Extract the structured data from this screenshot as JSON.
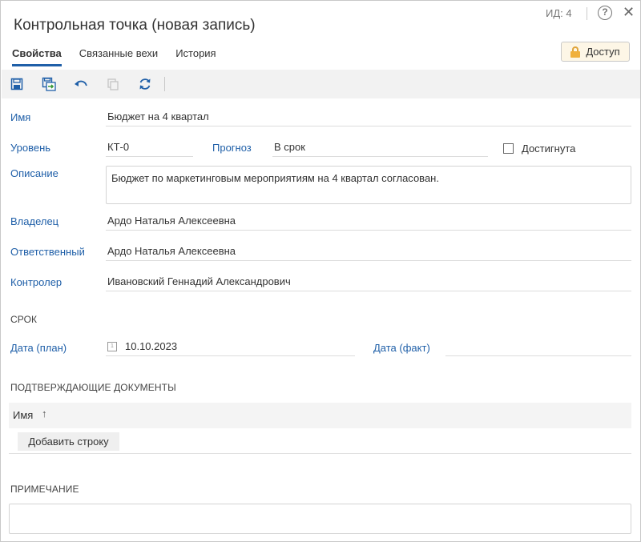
{
  "header": {
    "title": "Контрольная точка (новая запись)",
    "id_label": "ИД: 4",
    "help_symbol": "?",
    "close_symbol": "✕"
  },
  "tabs": [
    {
      "label": "Свойства",
      "active": true
    },
    {
      "label": "Связанные вехи",
      "active": false
    },
    {
      "label": "История",
      "active": false
    }
  ],
  "access_button": {
    "label": "Доступ",
    "icon": "lock-icon"
  },
  "toolbar": {
    "buttons": [
      "save-icon",
      "save-and-close-icon",
      "undo-icon",
      "copy-icon",
      "refresh-icon"
    ]
  },
  "form": {
    "name_label": "Имя",
    "name_value": "Бюджет на 4 квартал",
    "level_label": "Уровень",
    "level_value": "КТ-0",
    "forecast_label": "Прогноз",
    "forecast_value": "В срок",
    "achieved_label": "Достигнута",
    "achieved_checked": false,
    "description_label": "Описание",
    "description_value": "Бюджет по маркетинговым мероприятиям на 4 квартал согласован.",
    "owner_label": "Владелец",
    "owner_value": "Ардо Наталья Алексеевна",
    "responsible_label": "Ответственный",
    "responsible_value": "Ардо Наталья Алексеевна",
    "controller_label": "Контролер",
    "controller_value": "Ивановский Геннадий Александрович"
  },
  "deadline": {
    "section_title": "СРОК",
    "plan_label": "Дата (план)",
    "plan_value": "10.10.2023",
    "fact_label": "Дата (факт)",
    "fact_value": ""
  },
  "documents": {
    "section_title": "ПОДТВЕРЖДАЮЩИЕ ДОКУМЕНТЫ",
    "column_name": "Имя",
    "sort_symbol": "↑",
    "add_row_label": "Добавить строку"
  },
  "note": {
    "section_title": "ПРИМЕЧАНИЕ",
    "value": ""
  },
  "colors": {
    "label_blue": "#1f5fa8",
    "access_bg": "#fdf6e6",
    "lock_yellow": "#f0b03c"
  }
}
